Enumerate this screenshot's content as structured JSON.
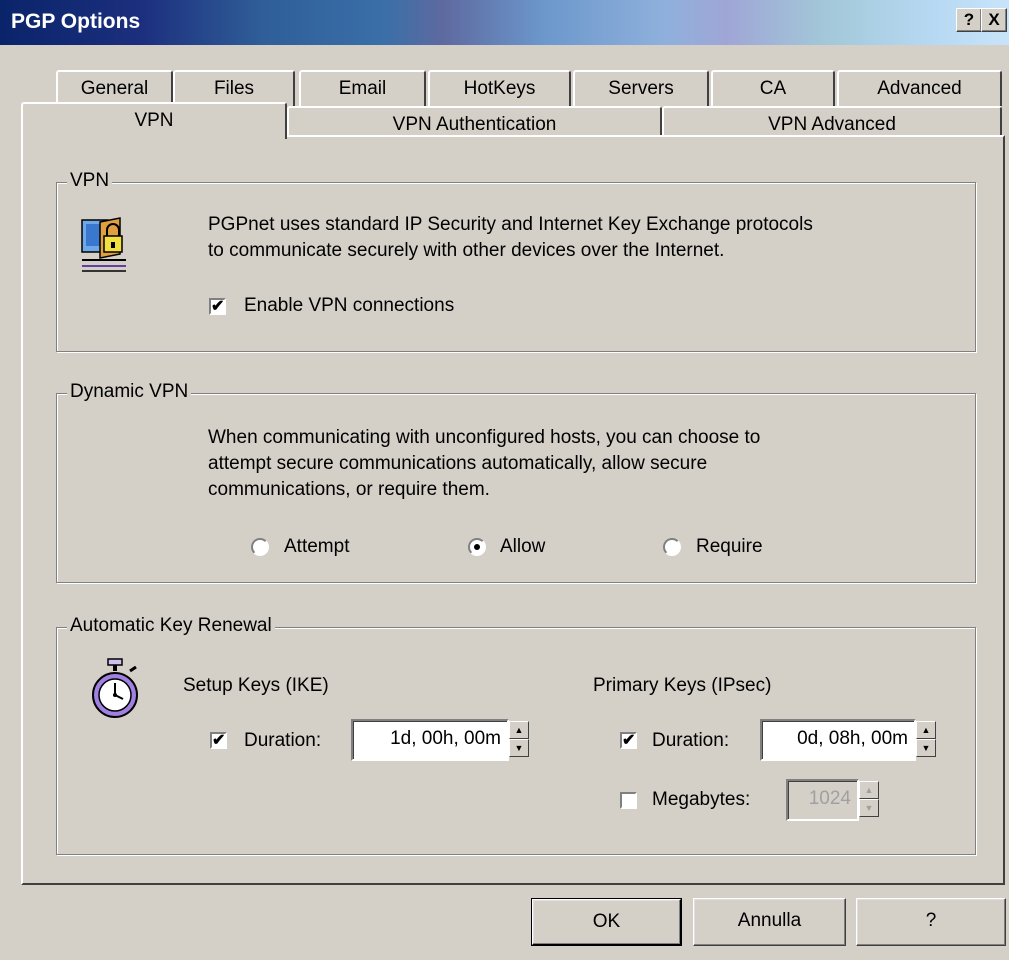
{
  "window": {
    "title": "PGP Options",
    "help_button": "?",
    "close_button": "X"
  },
  "tabs_back": [
    {
      "label": "General"
    },
    {
      "label": "Files"
    },
    {
      "label": "Email"
    },
    {
      "label": "HotKeys"
    },
    {
      "label": "Servers"
    },
    {
      "label": "CA"
    },
    {
      "label": "Advanced"
    }
  ],
  "tabs_front": [
    {
      "label": "VPN",
      "selected": true
    },
    {
      "label": "VPN Authentication",
      "selected": false
    },
    {
      "label": "VPN Advanced",
      "selected": false
    }
  ],
  "vpn_group": {
    "title": "VPN",
    "icon": "vpn-folder-lock-icon",
    "description_line1": "PGPnet uses standard IP Security and Internet Key Exchange protocols",
    "description_line2": "to communicate securely with other devices over the Internet.",
    "enable_label": "Enable VPN connections",
    "enable_checked": true
  },
  "dynamic_group": {
    "title": "Dynamic VPN",
    "description_line1": "When communicating with unconfigured hosts, you can choose to",
    "description_line2": "attempt secure communications automatically, allow secure",
    "description_line3": "communications, or require them.",
    "options": [
      {
        "label": "Attempt",
        "selected": false
      },
      {
        "label": "Allow",
        "selected": true
      },
      {
        "label": "Require",
        "selected": false
      }
    ]
  },
  "renewal_group": {
    "title": "Automatic Key Renewal",
    "icon": "stopwatch-icon",
    "setup_keys": {
      "heading": "Setup Keys (IKE)",
      "duration_label": "Duration:",
      "duration_checked": true,
      "duration_value": "1d, 00h, 00m"
    },
    "primary_keys": {
      "heading": "Primary Keys (IPsec)",
      "duration_label": "Duration:",
      "duration_checked": true,
      "duration_value": "0d, 08h, 00m",
      "megabytes_label": "Megabytes:",
      "megabytes_checked": false,
      "megabytes_value": "1024"
    }
  },
  "buttons": {
    "ok": "OK",
    "cancel": "Annulla",
    "help": "?"
  },
  "glyphs": {
    "check": "✔",
    "spin_up": "▲",
    "spin_down": "▼"
  }
}
